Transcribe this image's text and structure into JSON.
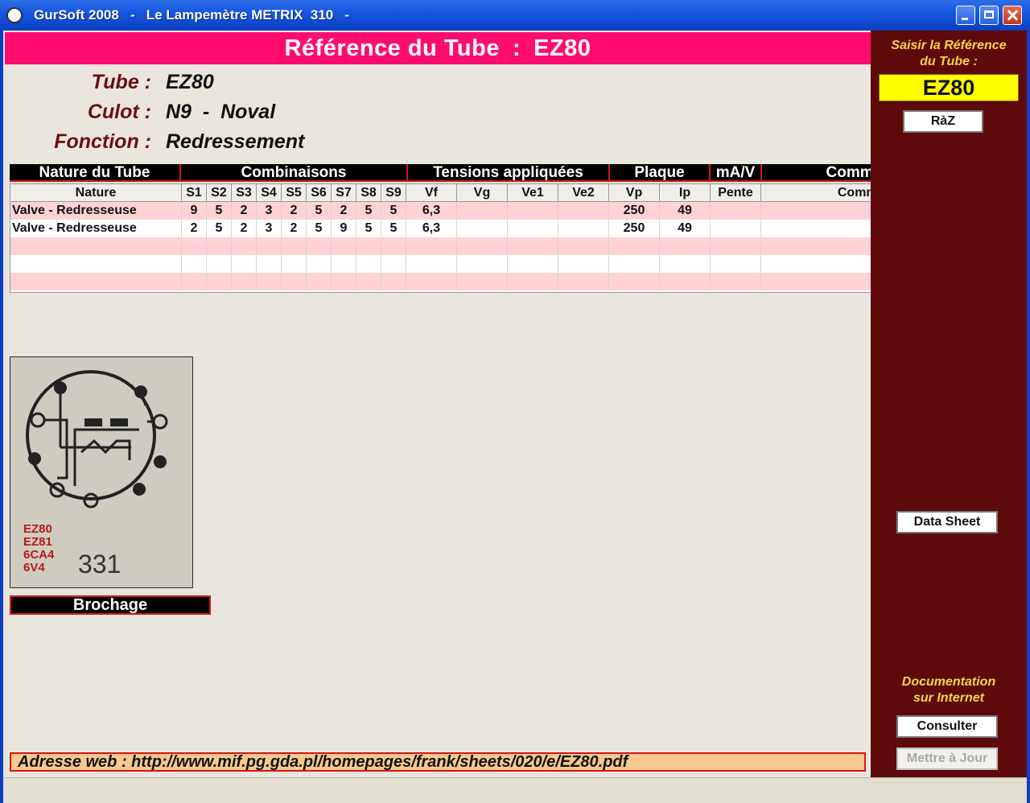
{
  "window": {
    "title": "GurSoft 2008   -   Le Lampemètre METRIX  310   -"
  },
  "banner": {
    "label": "Référence du Tube",
    "separator": ":",
    "value": "EZ80"
  },
  "info": {
    "tube_label": "Tube :",
    "tube_value": "EZ80",
    "culot_label": "Culot :",
    "culot_value": "N9  -  Noval",
    "fonction_label": "Fonction :",
    "fonction_value": "Redressement"
  },
  "group_headers": [
    "Nature du Tube",
    "Combinaisons",
    "Tensions appliquées",
    "Plaque",
    "mA/V",
    "Commentaires"
  ],
  "columns": [
    "Nature",
    "S1",
    "S2",
    "S3",
    "S4",
    "S5",
    "S6",
    "S7",
    "S8",
    "S9",
    "Vf",
    "Vg",
    "Ve1",
    "Ve2",
    "Vp",
    "Ip",
    "Pente",
    "Commentaire"
  ],
  "rows": [
    [
      "Valve - Redresseuse",
      "9",
      "5",
      "2",
      "3",
      "2",
      "5",
      "2",
      "5",
      "5",
      "6,3",
      "",
      "",
      "",
      "250",
      "49",
      "",
      ""
    ],
    [
      "Valve - Redresseuse",
      "2",
      "5",
      "2",
      "3",
      "2",
      "5",
      "9",
      "5",
      "5",
      "6,3",
      "",
      "",
      "",
      "250",
      "49",
      "",
      ""
    ],
    [
      "",
      "",
      "",
      "",
      "",
      "",
      "",
      "",
      "",
      "",
      "",
      "",
      "",
      "",
      "",
      "",
      "",
      ""
    ],
    [
      "",
      "",
      "",
      "",
      "",
      "",
      "",
      "",
      "",
      "",
      "",
      "",
      "",
      "",
      "",
      "",
      "",
      ""
    ],
    [
      "",
      "",
      "",
      "",
      "",
      "",
      "",
      "",
      "",
      "",
      "",
      "",
      "",
      "",
      "",
      "",
      "",
      ""
    ]
  ],
  "pinout_image": {
    "labels": [
      "EZ80",
      "EZ81",
      "6CA4",
      "6V4"
    ],
    "number": "331"
  },
  "brochage_label": "Brochage",
  "web_address": "Adresse web : http://www.mif.pg.gda.pl/homepages/frank/sheets/020/e/EZ80.pdf",
  "sidebar": {
    "saisir_label_line1": "Saisir la Référence",
    "saisir_label_line2": "du Tube :",
    "reference_value": "EZ80",
    "raz_button": "RàZ",
    "datasheet_button": "Data Sheet",
    "doc_label_line1": "Documentation",
    "doc_label_line2": "sur Internet",
    "consulter_button": "Consulter",
    "update_button": "Mettre à Jour"
  },
  "colors": {
    "banner": "#ff0d6e",
    "sidebar": "#5e0a0a",
    "row_alt": "#ffd3d5",
    "accent_text": "#f5d547"
  }
}
